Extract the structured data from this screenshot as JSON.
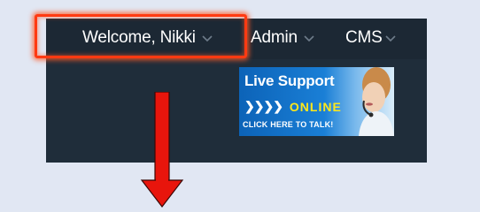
{
  "nav": {
    "items": [
      {
        "label": "Welcome, Nikki",
        "icon": "chevron-down-icon"
      },
      {
        "label": "Admin",
        "icon": "chevron-down-icon"
      },
      {
        "label": "CMS",
        "icon": "chevron-down-icon"
      }
    ]
  },
  "live_support": {
    "title": "Live Support",
    "arrows": "❯❯❯❯",
    "status": "ONLINE",
    "cta": "CLICK HERE TO TALK!"
  },
  "colors": {
    "background": "#e1e7f3",
    "navbar": "#1f2d3a",
    "highlight": "#ff3a12",
    "arrow": "#e8150c",
    "online": "#ffe71a"
  },
  "annotation": {
    "arrow_icon": "down-arrow-icon",
    "highlight": "highlight-box"
  }
}
